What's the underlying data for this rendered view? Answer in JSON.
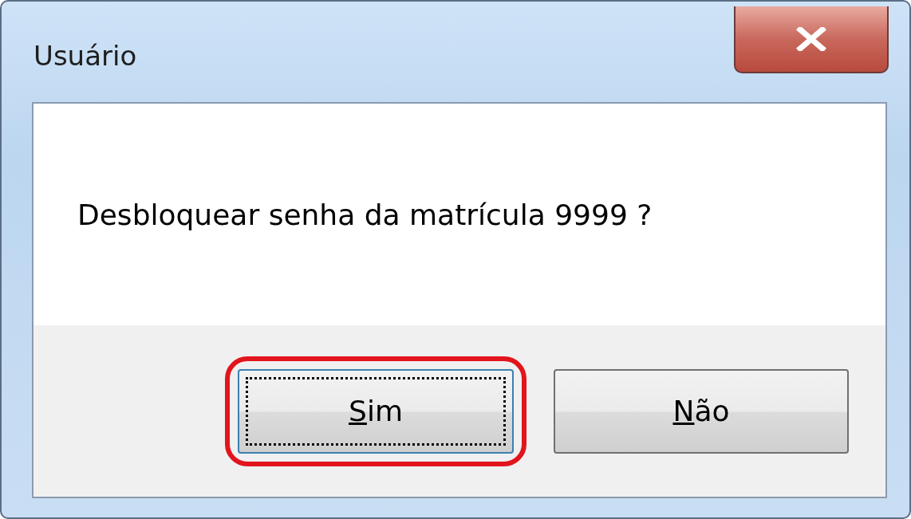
{
  "window": {
    "title": "Usuário"
  },
  "message": "Desbloquear senha da matrícula 9999 ?",
  "buttons": [
    {
      "mnemonic": "S",
      "rest": "im",
      "focused": true,
      "highlighted": true
    },
    {
      "mnemonic": "N",
      "rest": "ão",
      "focused": false,
      "highlighted": false
    }
  ]
}
